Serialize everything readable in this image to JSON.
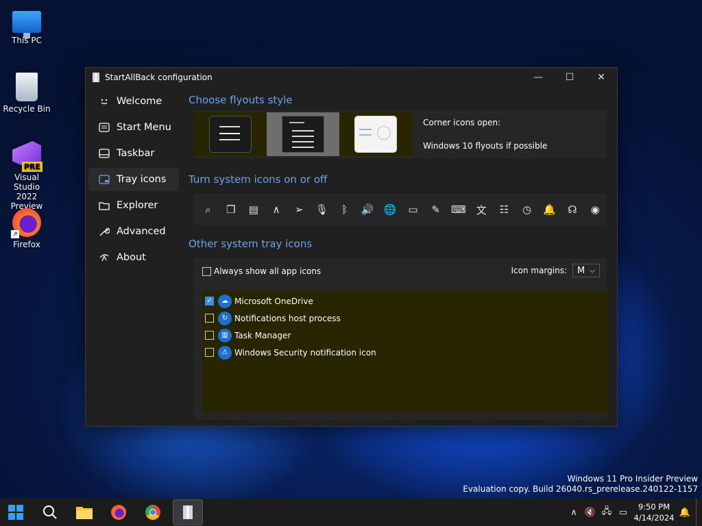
{
  "desktop": {
    "icons": [
      {
        "label": "This PC"
      },
      {
        "label": "Recycle Bin"
      },
      {
        "label": "Visual Studio 2022 Preview",
        "badge": "PRE"
      },
      {
        "label": "Firefox"
      }
    ]
  },
  "window": {
    "title": "StartAllBack configuration",
    "controls": {
      "minimize": "—",
      "maximize": "☐",
      "close": "✕"
    }
  },
  "sidebar": {
    "items": [
      {
        "label": "Welcome",
        "icon": "smile-icon"
      },
      {
        "label": "Start Menu",
        "icon": "start-menu-icon"
      },
      {
        "label": "Taskbar",
        "icon": "taskbar-icon"
      },
      {
        "label": "Tray icons",
        "icon": "tray-icon",
        "active": true
      },
      {
        "label": "Explorer",
        "icon": "folder-icon"
      },
      {
        "label": "Advanced",
        "icon": "wrench-icon"
      },
      {
        "label": "About",
        "icon": "about-icon"
      }
    ]
  },
  "flyouts": {
    "title": "Choose flyouts style",
    "selected_index": 1,
    "info_heading": "Corner icons open:",
    "info_value": "Windows 10 flyouts if possible"
  },
  "system_icons": {
    "title": "Turn system icons on or off",
    "icons": [
      {
        "name": "search-icon",
        "glyph": "⌕"
      },
      {
        "name": "task-view-icon",
        "glyph": "❐"
      },
      {
        "name": "widgets-icon",
        "glyph": "▤"
      },
      {
        "name": "chevron-up-icon",
        "glyph": "∧"
      },
      {
        "name": "location-icon",
        "glyph": "➢"
      },
      {
        "name": "microphone-icon",
        "glyph": "🎙"
      },
      {
        "name": "bluetooth-icon",
        "glyph": "ᛒ"
      },
      {
        "name": "volume-icon",
        "glyph": "🔊"
      },
      {
        "name": "network-globe-icon",
        "glyph": "🌐"
      },
      {
        "name": "battery-icon",
        "glyph": "▭"
      },
      {
        "name": "pen-icon",
        "glyph": "✎"
      },
      {
        "name": "keyboard-icon",
        "glyph": "⌨"
      },
      {
        "name": "language-icon",
        "glyph": "文"
      },
      {
        "name": "accessibility-icon",
        "glyph": "☷"
      },
      {
        "name": "clock-icon",
        "glyph": "◷"
      },
      {
        "name": "notification-bell-icon",
        "glyph": "🔔"
      },
      {
        "name": "copilot-icon",
        "glyph": "☊"
      },
      {
        "name": "eye-icon",
        "glyph": "◉"
      }
    ]
  },
  "other_tray": {
    "title": "Other system tray icons",
    "always_show_label": "Always show all app icons",
    "always_show_checked": false,
    "margins_label": "Icon margins:",
    "margins_value": "M",
    "items": [
      {
        "label": "Microsoft OneDrive",
        "checked": true,
        "icon": "onedrive-icon",
        "glyph": "☁"
      },
      {
        "label": "Notifications host process",
        "checked": false,
        "icon": "notifications-host-icon",
        "glyph": "↻"
      },
      {
        "label": "Task Manager",
        "checked": false,
        "icon": "task-manager-icon",
        "glyph": "▥"
      },
      {
        "label": "Windows Security notification icon",
        "checked": false,
        "icon": "windows-security-icon",
        "glyph": "⚠"
      }
    ]
  },
  "watermark": {
    "line1": "Windows 11 Pro Insider Preview",
    "line2": "Evaluation copy. Build 26040.rs_prerelease.240122-1157"
  },
  "taskbar": {
    "apps": [
      {
        "name": "start-button"
      },
      {
        "name": "search-button"
      },
      {
        "name": "file-explorer-button"
      },
      {
        "name": "firefox-button"
      },
      {
        "name": "chrome-button"
      },
      {
        "name": "startallback-button",
        "active": true
      }
    ],
    "clock_time": "9:50 PM",
    "clock_date": "4/14/2024"
  }
}
